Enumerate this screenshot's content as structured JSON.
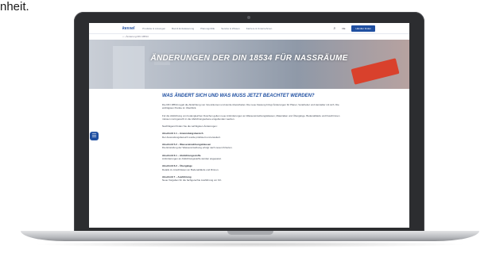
{
  "corner_text": "nheit.",
  "site": {
    "logo": "kessel",
    "nav": [
      "Produkte & Lösungen",
      "Bad & Entwässerung",
      "Planungshilfe",
      "Service & Wissen",
      "Karriere & Unternehmen"
    ],
    "search_icon": "search-icon",
    "language": "DE",
    "cta": "Händler finden",
    "breadcrumb": "⌂  ›  Änderung DIN 18534",
    "hero_title": "ÄNDERUNGEN DER DIN 18534 FÜR NASSRÄUME",
    "section_title": "WAS ÄNDERT SICH UND WAS MUSS JETZT BEACHTET WERDEN?",
    "paragraphs": [
      "Die DIN 18534 regelt die Abdichtung von Innenräumen und wurde überarbeitet. Die neue Fassung bringt Änderungen für Planer, Verarbeiter und Hersteller mit sich. Die wichtigsten Punkte im Überblick.",
      "Für die Abdichtung von bodengleichen Duschen gelten neue Anforderungen an Wassereinwirkungsklassen, Materialien und Übergänge. Bodenabläufe und Duschrinnen müssen normgerecht in die Abdichtungsebene eingebunden werden.",
      "Nachfolgend finden Sie die wichtigsten Änderungen:"
    ],
    "items": [
      {
        "heading": "Abschnitt 1.1 – Anwendungsbereich",
        "text": "Der Anwendungsbereich wurde präzisiert und erweitert."
      },
      {
        "heading": "Abschnitt 5.2 – Wassereinwirkungsklassen",
        "text": "Die Einstufung der Wassereinwirkung erfolgt nach neuen Kriterien."
      },
      {
        "heading": "Abschnitt 6.1 – Abdichtungsstoffe",
        "text": "Anforderungen an Abdichtungsstoffe wurden angepasst."
      },
      {
        "heading": "Abschnitt 6.2 – Übergänge",
        "text": "Details zu Anschlüssen an Bodenabläufe und Rinnen."
      },
      {
        "heading": "Abschnitt 7 – Ausführung",
        "text": "Neue Vorgaben für die fachgerechte Ausführung vor Ort."
      }
    ],
    "fab_icon": "chat-icon"
  },
  "colors": {
    "brand": "#1f4fa1",
    "accent": "#d9412c"
  }
}
